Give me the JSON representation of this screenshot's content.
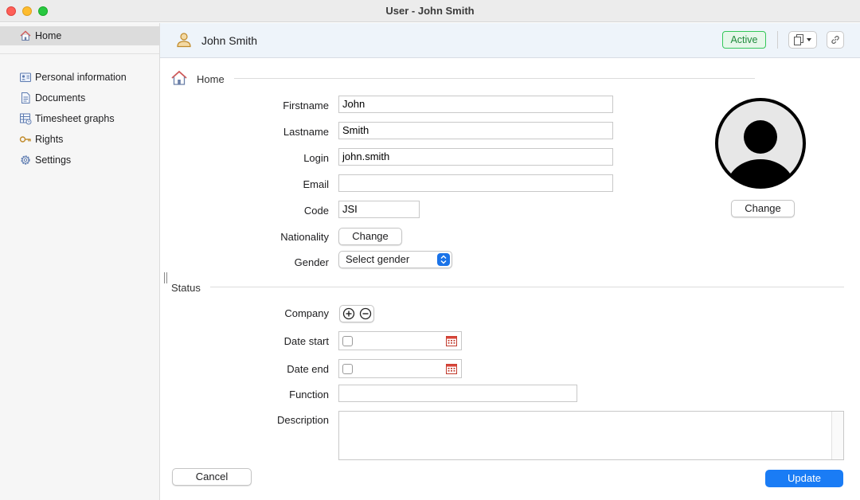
{
  "window": {
    "title": "User - John Smith"
  },
  "sidebar": {
    "items": [
      {
        "label": "Home",
        "icon": "home-icon"
      },
      {
        "label": "Personal information",
        "icon": "id-card-icon"
      },
      {
        "label": "Documents",
        "icon": "document-icon"
      },
      {
        "label": "Timesheet graphs",
        "icon": "timesheet-icon"
      },
      {
        "label": "Rights",
        "icon": "key-icon"
      },
      {
        "label": "Settings",
        "icon": "gear-icon"
      }
    ]
  },
  "header": {
    "user_name": "John Smith",
    "status": "Active"
  },
  "home_section": {
    "title": "Home"
  },
  "form": {
    "firstname": {
      "label": "Firstname",
      "value": "John"
    },
    "lastname": {
      "label": "Lastname",
      "value": "Smith"
    },
    "login": {
      "label": "Login",
      "value": "john.smith"
    },
    "email": {
      "label": "Email",
      "value": ""
    },
    "code": {
      "label": "Code",
      "value": "JSI"
    },
    "nationality": {
      "label": "Nationality",
      "button": "Change"
    },
    "gender": {
      "label": "Gender",
      "value": "Select gender"
    },
    "avatar_button": "Change"
  },
  "status_section": {
    "title": "Status",
    "company_label": "Company",
    "date_start_label": "Date start",
    "date_end_label": "Date end",
    "function_label": "Function",
    "description_label": "Description"
  },
  "footer": {
    "cancel": "Cancel",
    "update": "Update"
  },
  "colors": {
    "accent": "#1a7cf5",
    "active_badge": "#34c759",
    "header_bg": "#eef4fa"
  }
}
